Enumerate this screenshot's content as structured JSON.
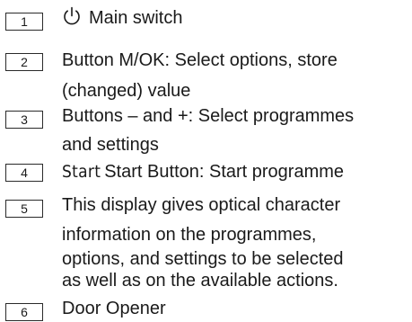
{
  "legend": {
    "items": [
      {
        "number": "1",
        "icon": "power-icon",
        "lines": [
          "Main switch"
        ]
      },
      {
        "number": "2",
        "lines": [
          "Button M/OK: Select options, store",
          "(changed) value"
        ]
      },
      {
        "number": "3",
        "lines": [
          "Buttons – and +: Select programmes",
          "and settings"
        ]
      },
      {
        "number": "4",
        "label_word": "Start",
        "lines": [
          "Start Button: Start programme"
        ]
      },
      {
        "number": "5",
        "lines": [
          "This display gives optical character",
          "information on the programmes,",
          "options, and settings to be selected",
          "as well as on the available actions."
        ]
      },
      {
        "number": "6",
        "lines": [
          "Door Opener"
        ]
      }
    ]
  }
}
